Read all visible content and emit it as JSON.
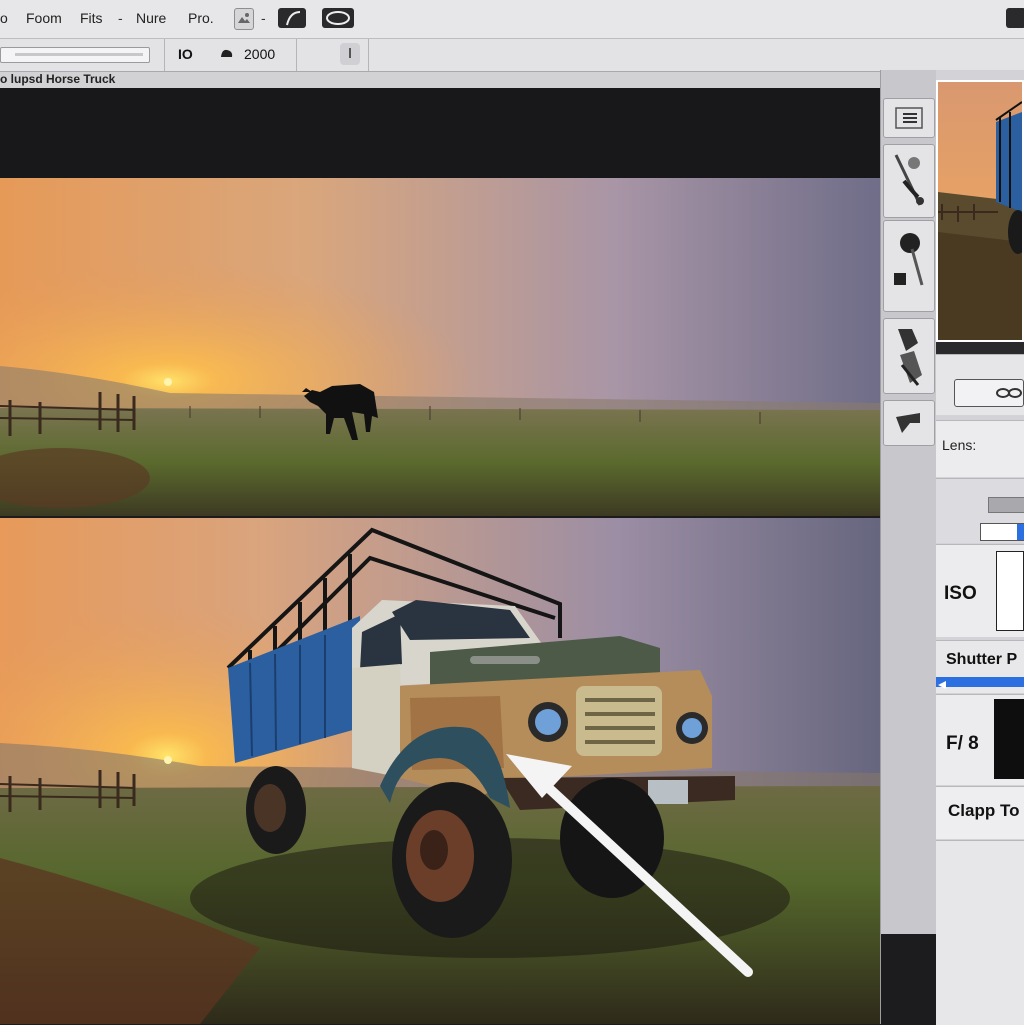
{
  "menu": {
    "items": [
      "o",
      "Foom",
      "Fits",
      "-",
      "Nure",
      "Pro.",
      "-"
    ]
  },
  "options": {
    "size_label": "IO",
    "value": "2000"
  },
  "document": {
    "title": "o lupsd Horse Truck"
  },
  "panel": {
    "lens_label": "Lens:",
    "iso_label": "ISO",
    "shutter_label": "Shutter P",
    "aperture_label": "F/ 8",
    "clamp_label": "Clapp To"
  },
  "colors": {
    "accent": "#2b6fe0",
    "chrome": "#e7e7e9",
    "canvas": "#18181b"
  },
  "icons": {
    "layers": "list-icon",
    "brush": "brush-icon",
    "dodge": "dodge-icon",
    "move": "move-icon",
    "crop": "crop-icon"
  }
}
